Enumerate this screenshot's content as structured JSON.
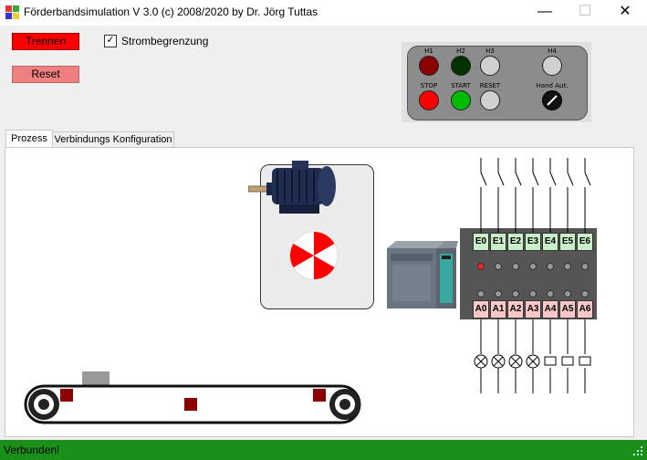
{
  "window": {
    "title": "Förderbandsimulation V 3.0  (c) 2008/2020 by Dr. Jörg Tuttas",
    "minimize_glyph": "—",
    "maximize_glyph": "☐",
    "close_glyph": "✕"
  },
  "controls": {
    "disconnect_label": "Trennen",
    "reset_label": "Reset",
    "current_limit_label": "Strombegrenzung",
    "current_limit_checked": true,
    "check_glyph": "✓"
  },
  "panel": {
    "top_labels": [
      "H1",
      "H2",
      "H3",
      "H4"
    ],
    "top_colors": [
      "#8b0000",
      "#003300",
      "#d0d0d0",
      "#d0d0d0"
    ],
    "bottom_labels": [
      "STOP",
      "START",
      "RESET",
      "Hand Aut."
    ],
    "bottom_colors": [
      "#ff0000",
      "#00bb00",
      "#d0d0d0",
      "#111111"
    ]
  },
  "tabs": [
    {
      "label": "Prozess",
      "active": true
    },
    {
      "label": "Verbindungs Konfiguration",
      "active": false
    }
  ],
  "io": {
    "inputs": [
      "E0",
      "E1",
      "E2",
      "E3",
      "E4",
      "E5",
      "E6"
    ],
    "outputs": [
      "A0",
      "A1",
      "A2",
      "A3",
      "A4",
      "A5",
      "A6"
    ],
    "input_color": "#c8f0c8",
    "output_color": "#f8c8c8",
    "active_led_index": 0
  },
  "status": {
    "text": "Verbunden!",
    "color": "#1a8f1a"
  }
}
